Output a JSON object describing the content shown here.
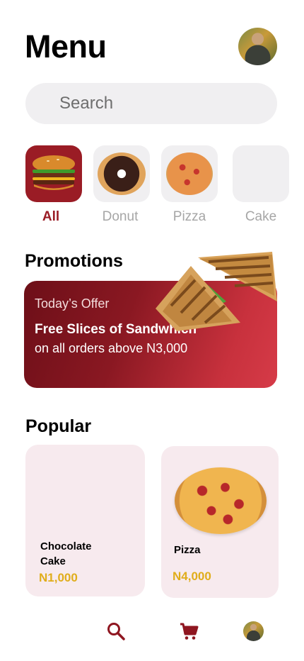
{
  "header": {
    "title": "Menu"
  },
  "search": {
    "placeholder": "Search"
  },
  "categories": [
    {
      "label": "All",
      "active": true
    },
    {
      "label": "Donut",
      "active": false
    },
    {
      "label": "Pizza",
      "active": false
    },
    {
      "label": "Cake",
      "active": false
    }
  ],
  "promotions": {
    "title": "Promotions",
    "kicker": "Today’s Offer",
    "headline": "Free Slices of Sandwhich",
    "subline": "on all orders above N3,000"
  },
  "popular": {
    "title": "Popular",
    "items": [
      {
        "name_line1": "Chocolate",
        "name_line2": "Cake",
        "price": "N1,000"
      },
      {
        "name_line1": "Pizza",
        "name_line2": "",
        "price": "N4,000"
      }
    ]
  },
  "colors": {
    "accent": "#9a1c25",
    "price": "#e0ad1b",
    "card_bg": "#f7eaee",
    "chip_bg": "#f0eff1"
  },
  "bottom_nav": {
    "icons": [
      "search-icon",
      "cart-icon",
      "profile-avatar"
    ]
  }
}
